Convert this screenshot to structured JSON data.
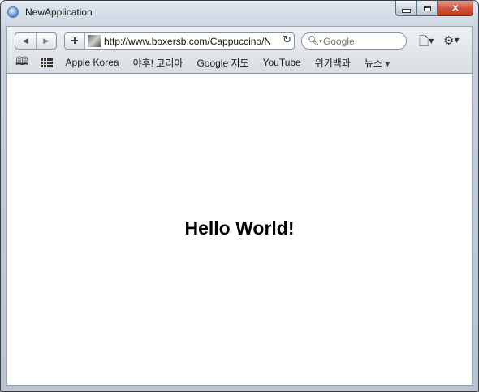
{
  "window": {
    "title": "NewApplication"
  },
  "toolbar": {
    "back_glyph": "◀",
    "forward_glyph": "▶",
    "add_glyph": "+",
    "url": "http://www.boxersb.com/Cappuccino/N",
    "reload_glyph": "↻",
    "search_placeholder": "Google",
    "page_menu_glyph": "🗋",
    "settings_glyph": "⚙"
  },
  "bookmarks": {
    "items": [
      "Apple Korea",
      "야후! 코리아",
      "Google 지도",
      "YouTube",
      "위키백과",
      "뉴스"
    ],
    "more_glyph": "▼"
  },
  "content": {
    "heading": "Hello World!"
  },
  "colors": {
    "frame": "#c8d2de",
    "close_button": "#c8432a",
    "content_bg": "#ffffff"
  }
}
